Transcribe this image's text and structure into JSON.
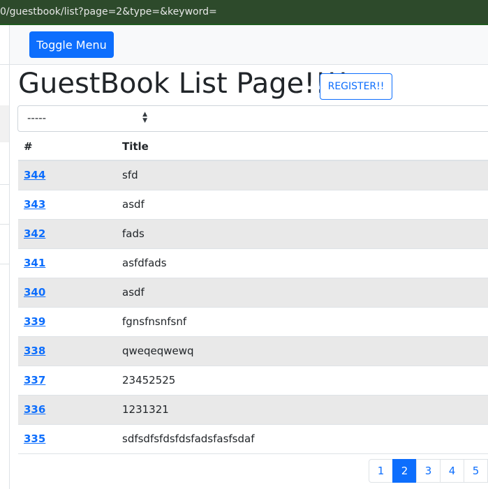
{
  "browser": {
    "url": "0/guestbook/list?page=2&type=&keyword="
  },
  "navbar": {
    "toggle_label": "Toggle Menu"
  },
  "page": {
    "title": "GuestBook List Page!!!!",
    "register_label": "REGISTER!!"
  },
  "search": {
    "type_selected": "-----",
    "keyword": ""
  },
  "table": {
    "headers": {
      "num": "#",
      "title": "Title"
    },
    "rows": [
      {
        "num": "344",
        "title": "sfd"
      },
      {
        "num": "343",
        "title": "asdf"
      },
      {
        "num": "342",
        "title": "fads"
      },
      {
        "num": "341",
        "title": "asfdfads"
      },
      {
        "num": "340",
        "title": "asdf"
      },
      {
        "num": "339",
        "title": "fgnsfnsnfsnf"
      },
      {
        "num": "338",
        "title": "qweqeqwewq"
      },
      {
        "num": "337",
        "title": "23452525"
      },
      {
        "num": "336",
        "title": "1231321"
      },
      {
        "num": "335",
        "title": "sdfsdfsfdsfdsfadsfasfsdaf"
      }
    ]
  },
  "pagination": {
    "pages": [
      "1",
      "2",
      "3",
      "4",
      "5"
    ],
    "active": "2"
  },
  "colors": {
    "primary": "#0d6efd",
    "stripe": "#e9e9e9",
    "urlbar": "#2d4a2b"
  }
}
